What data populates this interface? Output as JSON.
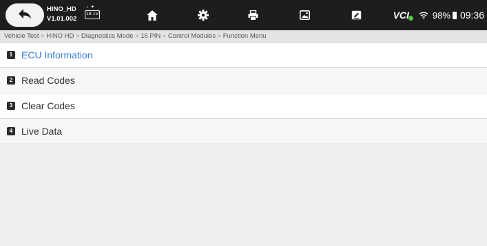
{
  "header": {
    "app_name": "HINO_HD",
    "app_version": "V1.01.002",
    "battery_voltage": "19.1V",
    "toolbar_icons": [
      "home-icon",
      "settings-icon",
      "print-icon",
      "screenshot-icon",
      "edit-icon"
    ],
    "status": {
      "vci_label": "VCI",
      "vci_color": "#4ecb3c",
      "battery_percent": "98%",
      "time": "09:36"
    }
  },
  "breadcrumb": [
    "Vehicle Test",
    "HINO HD",
    "Diagnostics Mode",
    "16 PIN",
    "Control Modules",
    "Function Menu"
  ],
  "menu": {
    "active_color": "#3a7bd5",
    "items": [
      {
        "number": "1",
        "label": "ECU Information"
      },
      {
        "number": "2",
        "label": "Read Codes"
      },
      {
        "number": "3",
        "label": "Clear Codes"
      },
      {
        "number": "4",
        "label": "Live Data"
      }
    ]
  }
}
